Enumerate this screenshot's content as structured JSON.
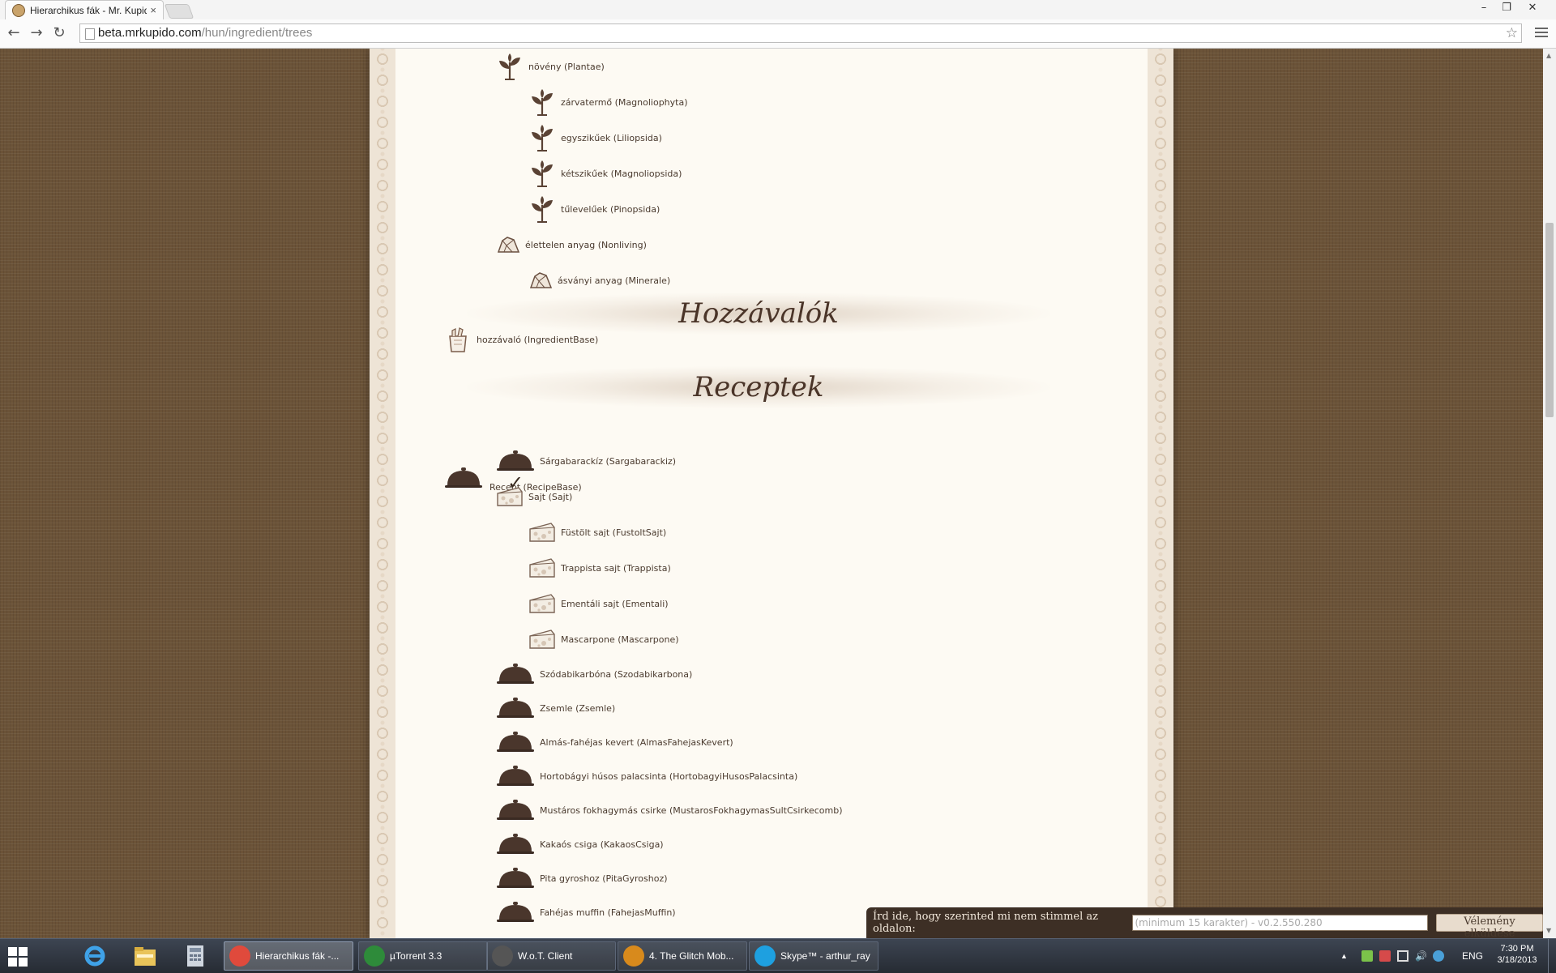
{
  "browser": {
    "tab_title": "Hierarchikus fák - Mr. Kupido",
    "tab_close": "×",
    "url_host": "beta.mrkupido.com",
    "url_path": "/hun/ingredient/trees",
    "window_controls": [
      "–",
      "❐",
      "✕"
    ]
  },
  "tree": {
    "plants": [
      {
        "label": "növény (Plantae)",
        "icon": "plant-icon"
      },
      {
        "label": "zárvatermő (Magnoliophyta)",
        "icon": "plant-icon"
      },
      {
        "label": "egyszikűek (Liliopsida)",
        "icon": "plant-icon"
      },
      {
        "label": "kétszikűek (Magnoliopsida)",
        "icon": "plant-icon"
      },
      {
        "label": "tűlevelűek (Pinopsida)",
        "icon": "plant-icon"
      },
      {
        "label": "élettelen anyag (Nonliving)",
        "icon": "mineral-icon"
      },
      {
        "label": "ásványi anyag (Minerale)",
        "icon": "mineral-icon"
      }
    ],
    "section_ingredients": "Hozzávalók",
    "ingredient_base": {
      "label": "hozzávaló (IngredientBase)",
      "icon": "grocery-bag-icon"
    },
    "section_recipes": "Receptek",
    "recipe_base": {
      "label": "Recept (RecipeBase)",
      "icon": "cloche-icon"
    },
    "checkmark": "✓",
    "recipes_a": [
      {
        "label": "Sárgabarackíz (Sargabarackiz)",
        "icon": "cloche-icon"
      },
      {
        "label": "Sajt (Sajt)",
        "icon": "cheese-icon"
      },
      {
        "label": "Füstölt sajt (FustoltSajt)",
        "icon": "cheese-icon"
      },
      {
        "label": "Trappista sajt (Trappista)",
        "icon": "cheese-icon"
      },
      {
        "label": "Ementáli sajt (Ementali)",
        "icon": "cheese-icon"
      },
      {
        "label": "Mascarpone (Mascarpone)",
        "icon": "cheese-icon"
      }
    ],
    "recipes_b": [
      {
        "label": "Szódabikarbóna (Szodabikarbona)",
        "icon": "cloche-icon"
      },
      {
        "label": "Zsemle (Zsemle)",
        "icon": "cloche-icon"
      },
      {
        "label": "Almás-fahéjas kevert (AlmasFahejasKevert)",
        "icon": "cloche-icon"
      },
      {
        "label": "Hortobágyi húsos palacsinta (HortobagyiHusosPalacsinta)",
        "icon": "cloche-icon"
      },
      {
        "label": "Mustáros fokhagymás csirke (MustarosFokhagymasSultCsirkecomb)",
        "icon": "cloche-icon"
      },
      {
        "label": "Kakaós csiga (KakaosCsiga)",
        "icon": "cloche-icon"
      },
      {
        "label": "Pita gyroshoz (PitaGyroshoz)",
        "icon": "cloche-icon"
      },
      {
        "label": "Fahéjas muffin (FahejasMuffin)",
        "icon": "cloche-icon"
      }
    ]
  },
  "feedback": {
    "question": "Írd ide, hogy szerinted mi nem stimmel az oldalon:",
    "placeholder": "(minimum 15 karakter) - v0.2.550.280",
    "submit_label": "Vélemény elküldése"
  },
  "taskbar": {
    "tasks": [
      {
        "label": "Hierarchikus fák -...",
        "icon": "chrome-icon",
        "color": "#e04a3c"
      },
      {
        "label": "µTorrent 3.3",
        "icon": "utorrent-icon",
        "color": "#2e8b3a"
      },
      {
        "label": "W.o.T. Client",
        "icon": "wot-icon",
        "color": "#555555"
      },
      {
        "label": "4. The Glitch Mob...",
        "icon": "winamp-icon",
        "color": "#d88a1c"
      },
      {
        "label": "Skype™ - arthur_ray",
        "icon": "skype-icon",
        "color": "#1ea0e0"
      }
    ],
    "language": "ENG",
    "time": "7:30 PM",
    "date": "3/18/2013",
    "tray_chevron": "▲"
  }
}
